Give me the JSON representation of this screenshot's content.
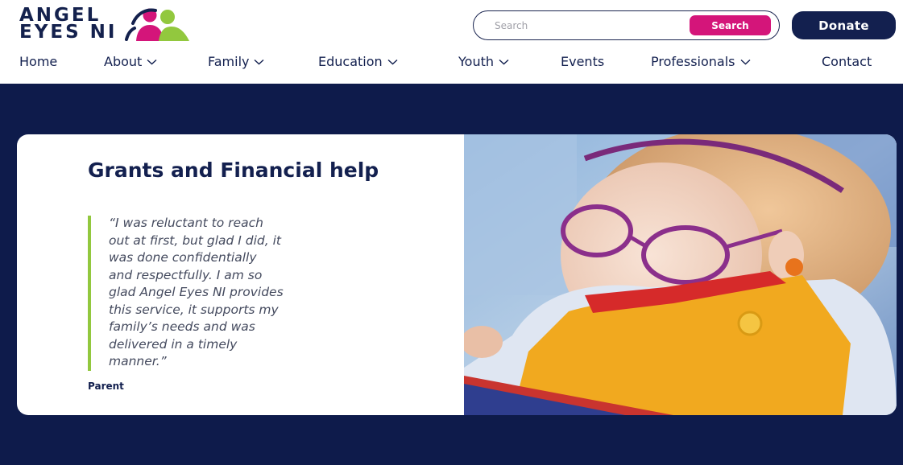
{
  "brand": {
    "name_line1": "ANGEL",
    "name_line2": "EYES NI"
  },
  "search": {
    "placeholder": "Search",
    "button_label": "Search"
  },
  "donate_label": "Donate",
  "nav": [
    {
      "label": "Home",
      "has_dropdown": false
    },
    {
      "label": "About",
      "has_dropdown": true
    },
    {
      "label": "Family",
      "has_dropdown": true
    },
    {
      "label": "Education",
      "has_dropdown": true
    },
    {
      "label": "Youth",
      "has_dropdown": true
    },
    {
      "label": "Events",
      "has_dropdown": false
    },
    {
      "label": "Professionals",
      "has_dropdown": true
    },
    {
      "label": "Contact",
      "has_dropdown": false
    }
  ],
  "hero": {
    "heading": "Grants and Financial help",
    "quote_lines": [
      "“I was reluctant to reach",
      "out at first, but glad I did, it",
      "was done confidentially",
      "and respectfully.  I am so",
      "glad Angel Eyes NI provides",
      "this service, it supports my",
      "family’s needs and was",
      "delivered in a timely",
      "manner.”"
    ],
    "attribution": "Parent"
  },
  "colors": {
    "navy": "#13204f",
    "hero_background": "#0e1b4b",
    "accent_pink": "#d4157a",
    "accent_green": "#92c83e"
  },
  "icons": {
    "nav_dropdown": "chevron-down-icon"
  }
}
